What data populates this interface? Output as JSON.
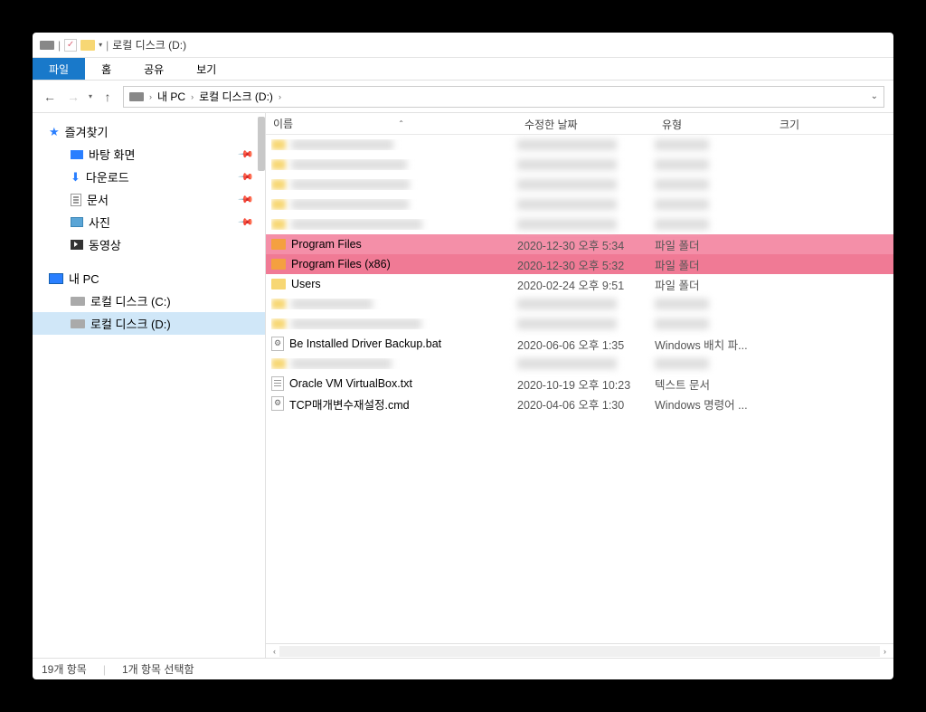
{
  "title": "로컬 디스크 (D:)",
  "menu": {
    "file": "파일",
    "home": "홈",
    "share": "공유",
    "view": "보기"
  },
  "breadcrumb": {
    "pc": "내 PC",
    "drive": "로컬 디스크 (D:)"
  },
  "sidebar": {
    "quickaccess": "즐겨찾기",
    "desktop": "바탕 화면",
    "downloads": "다운로드",
    "documents": "문서",
    "pictures": "사진",
    "videos": "동영상",
    "thispc": "내 PC",
    "driveC": "로컬 디스크 (C:)",
    "driveD": "로컬 디스크 (D:)"
  },
  "columns": {
    "name": "이름",
    "date": "수정한 날짜",
    "type": "유형",
    "size": "크기"
  },
  "rows": [
    {
      "kind": "blur"
    },
    {
      "kind": "blur"
    },
    {
      "kind": "blur"
    },
    {
      "kind": "blur"
    },
    {
      "kind": "blur"
    },
    {
      "kind": "folder-hl",
      "name": "Program Files",
      "date": "2020-12-30 오후 5:34",
      "type": "파일 폴더"
    },
    {
      "kind": "folder-hl2",
      "name": "Program Files (x86)",
      "date": "2020-12-30 오후 5:32",
      "type": "파일 폴더"
    },
    {
      "kind": "folder",
      "name": "Users",
      "date": "2020-02-24 오후 9:51",
      "type": "파일 폴더"
    },
    {
      "kind": "blur"
    },
    {
      "kind": "blur"
    },
    {
      "kind": "file-gear",
      "name": "Be Installed Driver Backup.bat",
      "date": "2020-06-06 오후 1:35",
      "type": "Windows 배치 파..."
    },
    {
      "kind": "blur"
    },
    {
      "kind": "file-txt",
      "name": "Oracle VM VirtualBox.txt",
      "date": "2020-10-19 오후 10:23",
      "type": "텍스트 문서"
    },
    {
      "kind": "file-gear",
      "name": "TCP매개변수재설정.cmd",
      "date": "2020-04-06 오후 1:30",
      "type": "Windows 명령어 ..."
    }
  ],
  "status": {
    "items": "19개 항목",
    "selected": "1개 항목 선택함"
  }
}
